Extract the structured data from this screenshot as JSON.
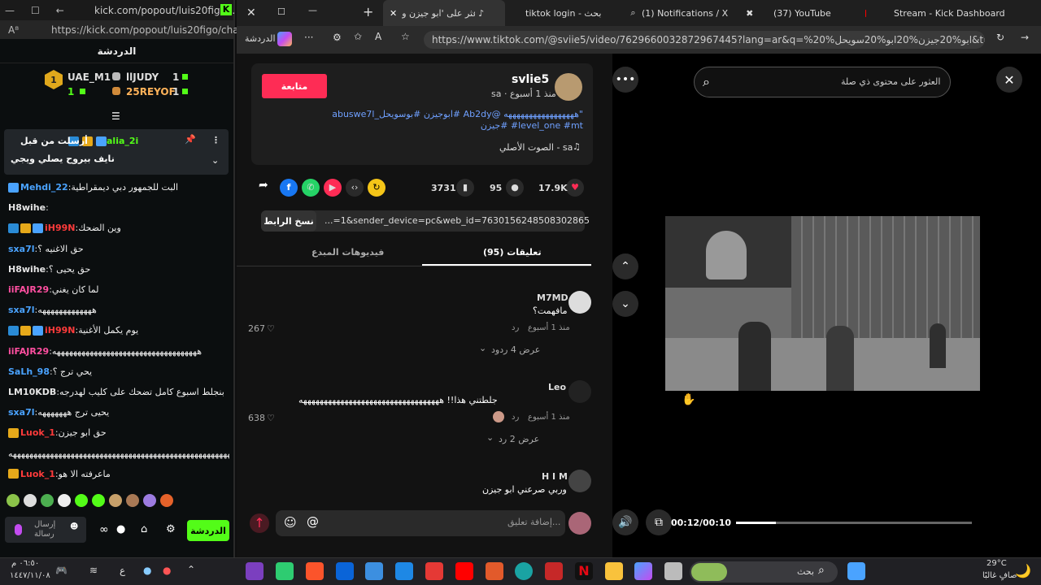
{
  "kick": {
    "window_title": "kick.com/popout/luis20figo...",
    "url": "https://kick.com/popout/luis20figo/chat",
    "header": "الدردشة",
    "gifters": [
      {
        "name": "UAE_M1",
        "count": "1"
      },
      {
        "name": "llJUDY",
        "count": "1"
      },
      {
        "name": "25REYOF",
        "count": "1"
      }
    ],
    "gifter_count_single": "1",
    "pinned": {
      "user": "alia_2i",
      "label": "أرسلت من قبل",
      "text": "نايف بيروح يصلي ويجي"
    },
    "messages": [
      {
        "user": "Mehdi_22",
        "text": "البت للجمهور دبي ديمقراطية",
        "color": "#4aa3ff"
      },
      {
        "user": "H8wihe",
        "text": "",
        "color": "#e5e5e5"
      },
      {
        "user": "iH99N",
        "text": "وين الضحك",
        "color": "#ff3b3b"
      },
      {
        "user": "sxa7l",
        "text": "حق الاغنيه ؟",
        "color": "#4aa3ff"
      },
      {
        "user": "H8wihe",
        "text": "حق يحيى ؟",
        "color": "#e5e5e5"
      },
      {
        "user": "iiFAJR29",
        "text": "لما كان يغني",
        "color": "#ff4fa0"
      },
      {
        "user": "sxa7l",
        "text": "هههههههههههههه",
        "color": "#4aa3ff"
      },
      {
        "user": "iH99N",
        "text": "يوم يكمل الأغنية",
        "color": "#ff3b3b"
      },
      {
        "user": "iiFAJR29",
        "text": "هههههههههههههههههههههههههههههههههههه",
        "color": "#ff4fa0"
      },
      {
        "user": "SaLh_98",
        "text": "يحي ترج ؟",
        "color": "#4aa3ff"
      },
      {
        "user": "LM10KDB",
        "text": "بنجلط اسبوع كامل تضحك على كليب لهدرجه",
        "color": "#e5e5e5"
      },
      {
        "user": "sxa7l",
        "text": "يحيى ترج هههههههه",
        "color": "#4aa3ff"
      },
      {
        "user": "Luok_1",
        "text": "حق ابو جيزن",
        "color": "#ff3b3b"
      },
      {
        "user": "",
        "text": "ههههههههههههههههههههههههههههههههههههههههههههههههههههههههههههه",
        "color": "#e5e5e5"
      },
      {
        "user": "Luok_1",
        "text": "ماعرفته الا هو",
        "color": "#ff3b3b"
      }
    ],
    "send_label": "الدردشة",
    "send_message_label": "إرسال رسالة"
  },
  "browser": {
    "tabs": [
      {
        "label": "اعثر على 'ابو جيزن و"
      },
      {
        "label": "tiktok login - بحث"
      },
      {
        "label": "(1) Notifications / X"
      },
      {
        "label": "(37) YouTube"
      },
      {
        "label": "Stream - Kick Dashboard"
      }
    ],
    "sidebar_label": "الدردشة",
    "url": "https://www.tiktok.com/@sviie5/video/7629660032872967445?lang=ar&q=%20%ابو%20جيزن%20ابو%20سويحل&t=1777045..."
  },
  "tiktok": {
    "author": "svlie5",
    "meta": "sa · منذ 1 أسبوع",
    "follow_label": "متابعة",
    "caption": "\"هههههههههههههههههه @Ab2dy #ابوجيزن #بوسويحل_abuswe7l #level_one #mt #جيزن",
    "sound": "الصوت الأصلي - sa",
    "likes": "17.9K",
    "comments_count": "95",
    "saves": "3731",
    "link": "...=1&sender_device=pc&web_id=7630156248508302865",
    "copy_link": "نسخ الرابط",
    "tab_comments": "تعليقات (95)",
    "tab_creator": "فيديوهات المبدع",
    "comments": [
      {
        "user": "M7MD",
        "text": "مافهمت؟",
        "time": "منذ 1 أسبوع",
        "reply": "رد",
        "likes": "267",
        "view": "عرض 4 ردود"
      },
      {
        "user": "Leo",
        "text": "جلطتني هذا!! ههههههههههههههههههههههههههههههههههه",
        "time": "منذ 1 أسبوع",
        "reply": "رد",
        "likes": "638",
        "view": "عرض 2 رد"
      },
      {
        "user": "H I M",
        "text": "وربي صرعني ابو جيزن"
      }
    ],
    "add_comment": "إضافة تعليق...",
    "search_placeholder": "العثور على محتوى ذي صلة",
    "time": "00:12/00:10",
    "progress": 0.17
  },
  "taskbar": {
    "search": "بحث",
    "weather_temp": "29°C",
    "weather_text": "صافٍ غالبًا",
    "time": "٠٦:٥٠ م",
    "date": "١٤٤٧/١١/٠٨",
    "lang": "ع"
  }
}
